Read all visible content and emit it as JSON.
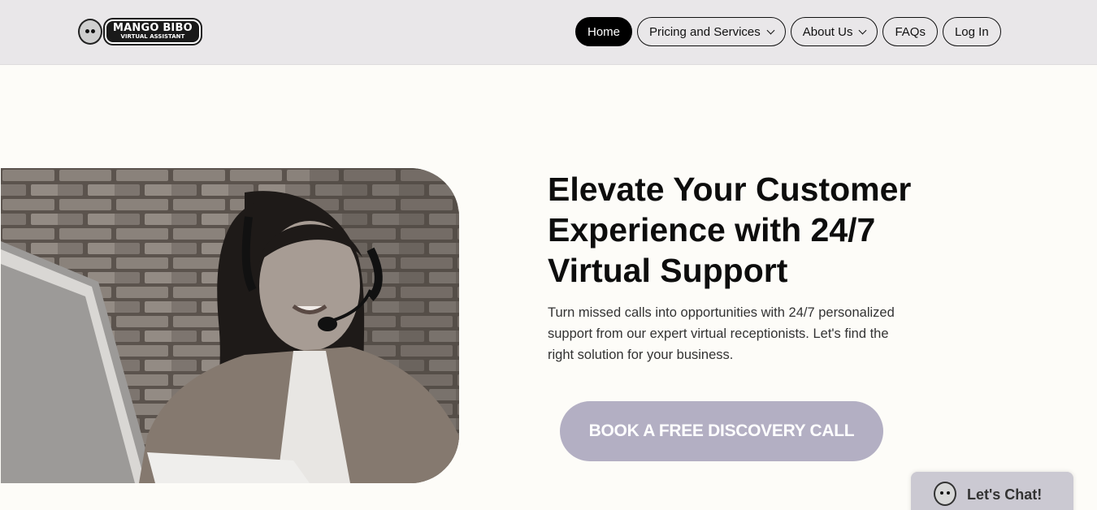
{
  "brand": {
    "name": "MANGO BIBO",
    "tagline": "VIRTUAL ASSISTANT"
  },
  "nav": {
    "items": [
      {
        "label": "Home",
        "active": true
      },
      {
        "label": "Pricing and Services",
        "dropdown": true
      },
      {
        "label": "About Us",
        "dropdown": true
      },
      {
        "label": "FAQs"
      },
      {
        "label": "Log In"
      }
    ]
  },
  "hero": {
    "headline_lines": [
      "Elevate Your Customer",
      "Experience with 24/7",
      "Virtual Support"
    ],
    "subtext_lines": [
      "Turn missed calls into opportunities with 24/7 personalized",
      "support from our expert virtual receptionists. Let's find the",
      "right solution for your business."
    ],
    "cta_label": "BOOK A FREE DISCOVERY CALL"
  },
  "chat": {
    "label": "Let's Chat!"
  },
  "colors": {
    "header_bg": "#e9e7e9",
    "page_bg": "#fdfcf8",
    "cta_bg": "#b3afc3",
    "chat_bg": "#cbc9d2"
  }
}
